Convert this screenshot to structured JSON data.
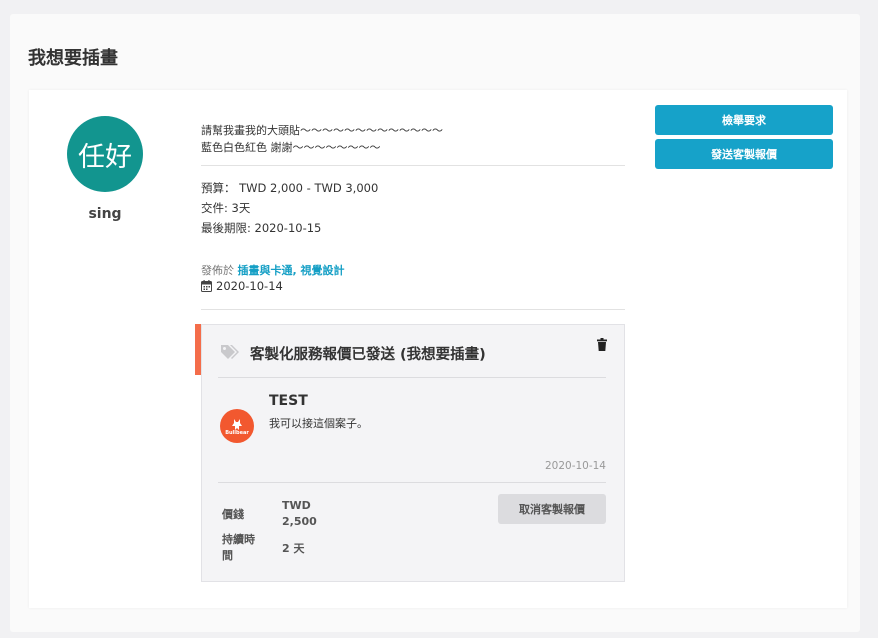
{
  "page": {
    "title": "我想要插畫"
  },
  "request": {
    "user": {
      "avatar_text": "任好",
      "name": "sing",
      "avatar_color": "#12958f"
    },
    "description_lines": [
      "請幫我畫我的大頭貼〜〜〜〜〜〜〜〜〜〜〜〜〜",
      "藍色白色紅色 謝謝〜〜〜〜〜〜〜〜"
    ],
    "budget": "預算： TWD 2,000 - TWD 3,000",
    "delivery": "交件: 3天",
    "deadline": "最後期限: 2020-10-15",
    "posted_prefix": "發佈於",
    "categories": "插畫與卡通, 視覺設計",
    "posted_date": "2020-10-14",
    "posted_date_icon": "calendar-icon"
  },
  "actions": {
    "report_label": "檢舉要求",
    "send_quote_label": "發送客製報價",
    "accent_color": "#16a2c9"
  },
  "quote": {
    "title": "客製化服務報價已發送 (我想要插畫)",
    "tag_icon": "tag-icon",
    "delete_icon": "trash-icon",
    "accent_color": "#f46d4a",
    "seller_logo_text": "Bullbear",
    "seller_name": "TEST",
    "message": "我可以接這個案子。",
    "date": "2020-10-14",
    "price_label": "價錢",
    "price_value": "TWD 2,500",
    "duration_label": "持續時間",
    "duration_value": "2 天",
    "cancel_label": "取消客製報價"
  }
}
